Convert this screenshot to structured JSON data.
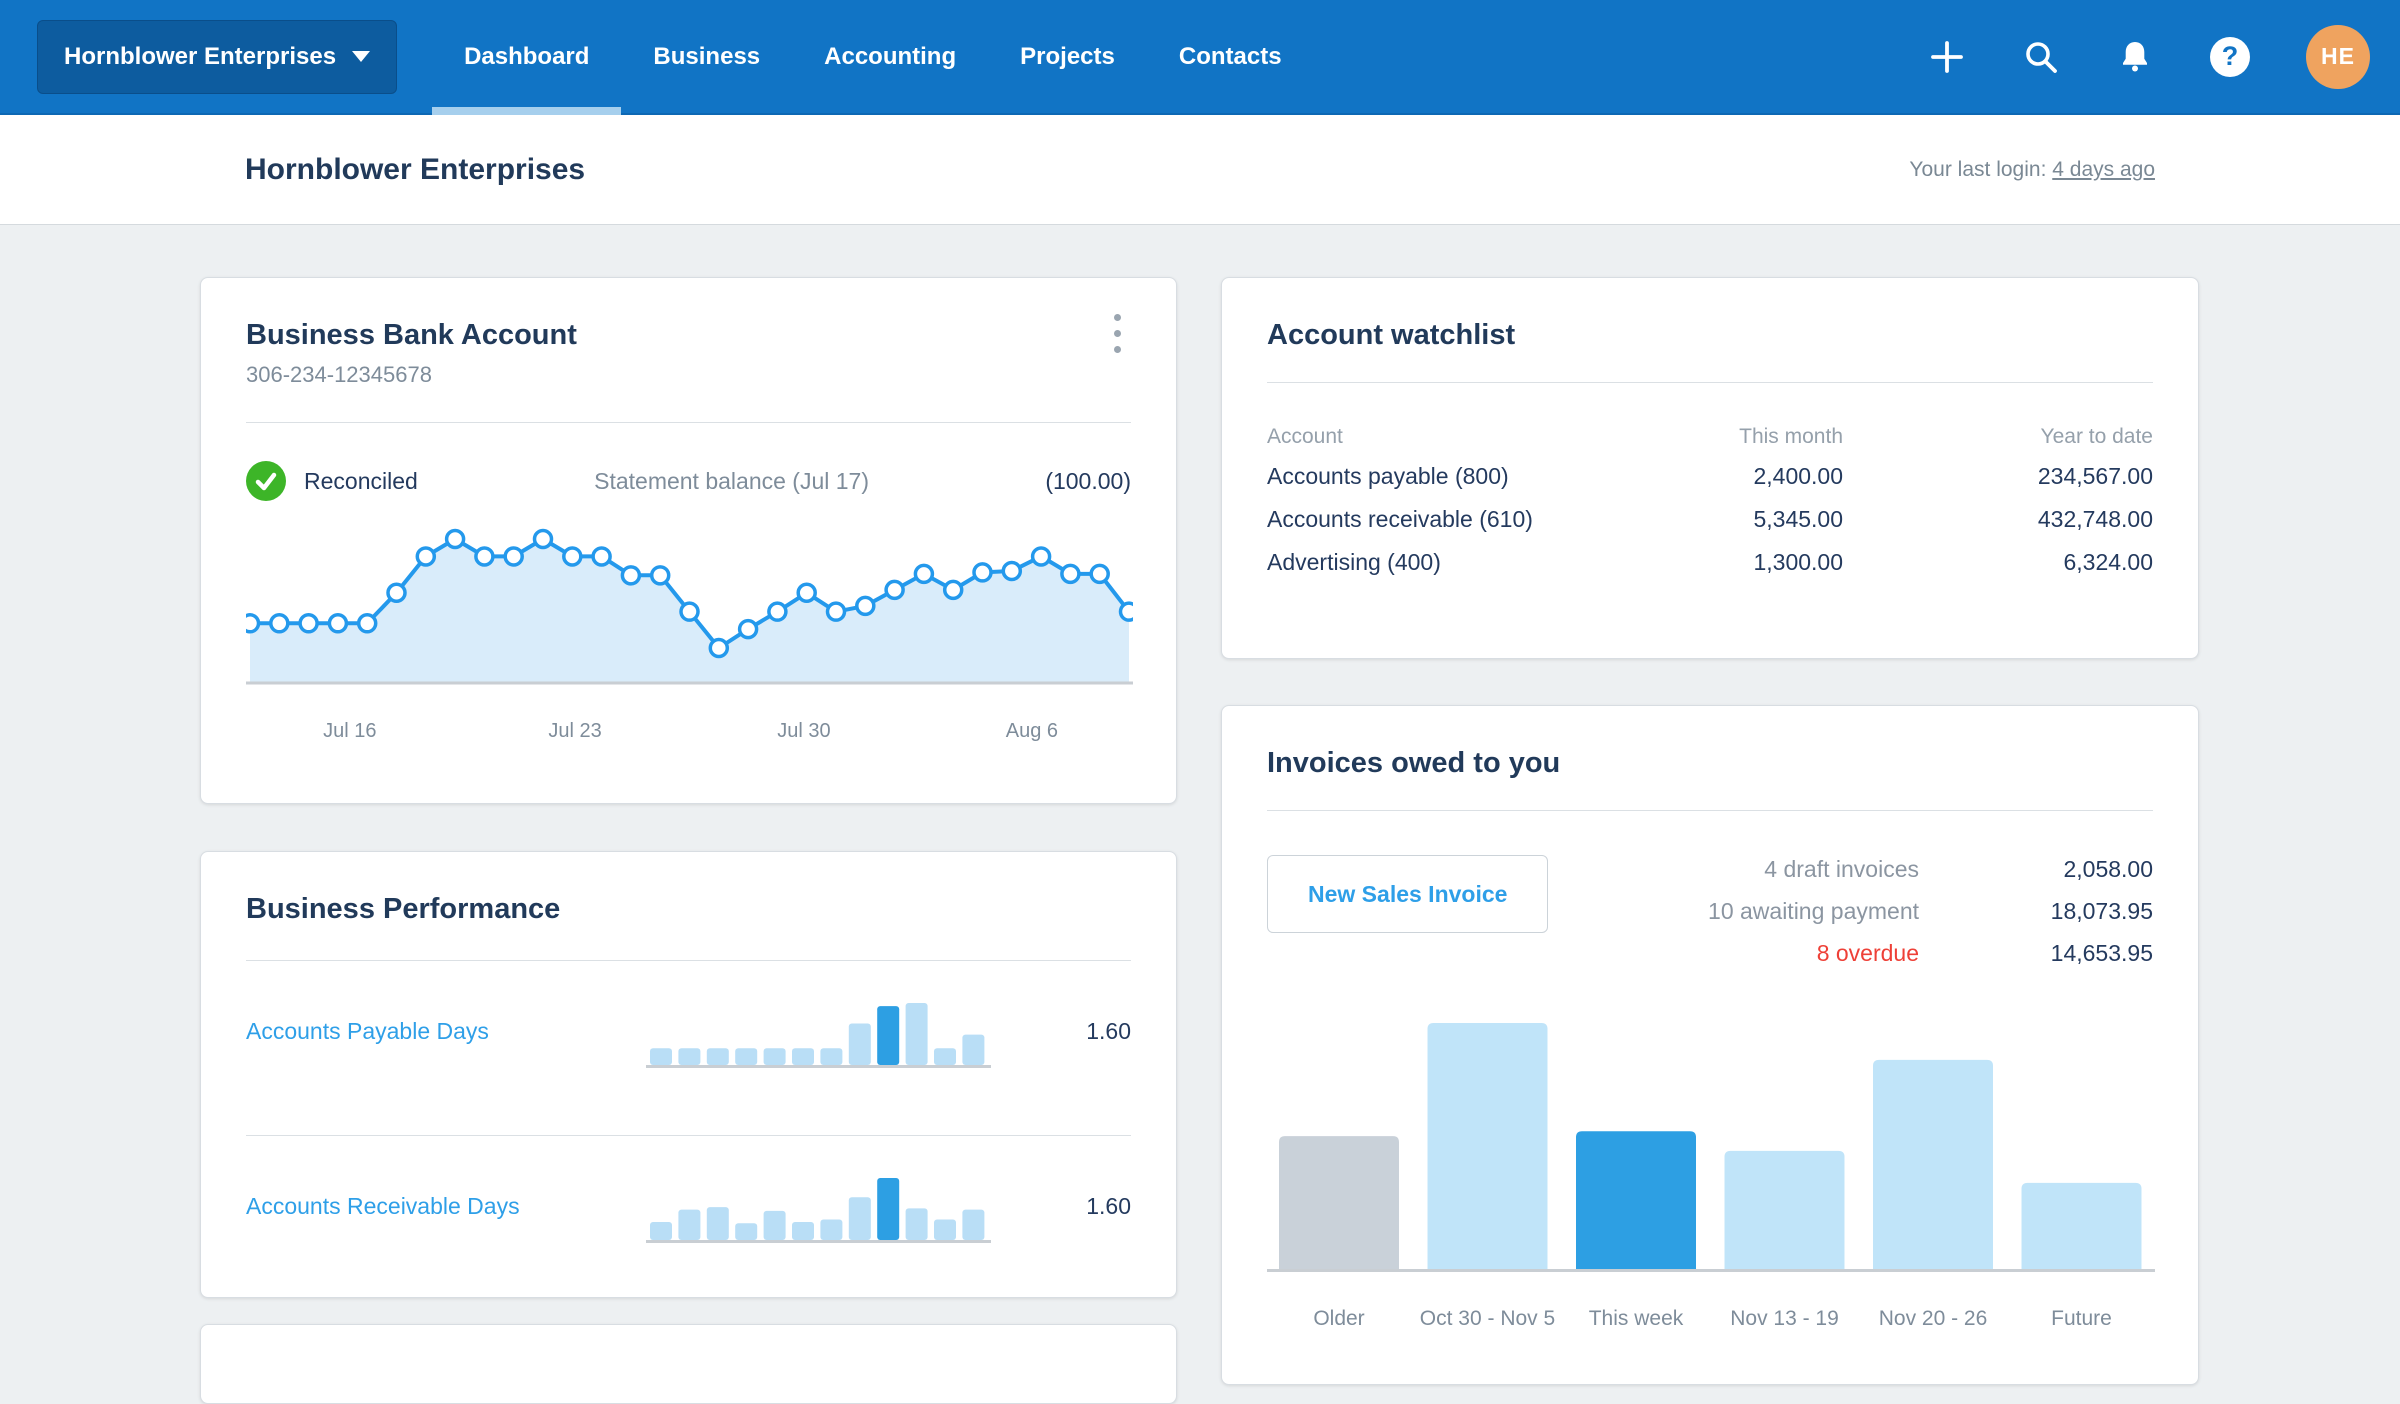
{
  "nav": {
    "org_name": "Hornblower Enterprises",
    "items": [
      {
        "label": "Dashboard",
        "active": true
      },
      {
        "label": "Business",
        "active": false
      },
      {
        "label": "Accounting",
        "active": false
      },
      {
        "label": "Projects",
        "active": false
      },
      {
        "label": "Contacts",
        "active": false
      }
    ],
    "icons": [
      "plus-icon",
      "search-icon",
      "bell-icon",
      "help-icon"
    ],
    "help_glyph": "?",
    "avatar_initials": "HE"
  },
  "header": {
    "title": "Hornblower Enterprises",
    "last_login_label": "Your last login:",
    "last_login_value": "4 days ago"
  },
  "bank_card": {
    "title": "Business Bank Account",
    "account_number": "306-234-12345678",
    "status": "Reconciled",
    "statement_label": "Statement balance (Jul 17)",
    "statement_value": "(100.00)"
  },
  "watchlist": {
    "title": "Account watchlist",
    "columns": [
      "Account",
      "This month",
      "Year to date"
    ],
    "rows": [
      {
        "account": "Accounts payable (800)",
        "this_month": "2,400.00",
        "year_to_date": "234,567.00"
      },
      {
        "account": "Accounts receivable (610)",
        "this_month": "5,345.00",
        "year_to_date": "432,748.00"
      },
      {
        "account": "Advertising (400)",
        "this_month": "1,300.00",
        "year_to_date": "6,324.00"
      }
    ]
  },
  "performance": {
    "title": "Business Performance",
    "rows": [
      {
        "label": "Accounts Payable Days",
        "value": "1.60",
        "spark": [
          27,
          27,
          27,
          27,
          27,
          27,
          27,
          67,
          95,
          100,
          27,
          49
        ],
        "highlight_index": 8
      },
      {
        "label": "Accounts Receivable Days",
        "value": "1.60",
        "spark": [
          29,
          49,
          53,
          27,
          47,
          29,
          33,
          69,
          100,
          51,
          33,
          49
        ],
        "highlight_index": 8
      }
    ]
  },
  "invoices": {
    "title": "Invoices owed to you",
    "new_invoice_button": "New Sales Invoice",
    "stats": [
      {
        "label": "4 draft invoices",
        "value": "2,058.00",
        "overdue": false
      },
      {
        "label": "10 awaiting payment",
        "value": "18,073.95",
        "overdue": false
      },
      {
        "label": "8 overdue",
        "value": "14,653.95",
        "overdue": true
      }
    ]
  },
  "chart_data": [
    {
      "type": "area",
      "title": "Business Bank Account balance sparkline",
      "x_tick_labels": [
        "Jul 16",
        "Jul 23",
        "Jul 30",
        "Aug 6"
      ],
      "x_tick_positions": [
        0.117,
        0.371,
        0.629,
        0.886
      ],
      "ylim": [
        0,
        100
      ],
      "values": [
        42,
        42,
        42,
        42,
        42,
        63,
        88,
        100,
        88,
        88,
        100,
        88,
        88,
        75,
        75,
        50,
        25,
        38,
        50,
        63,
        50,
        54,
        65,
        76,
        65,
        77,
        78,
        88,
        76,
        76,
        50
      ]
    },
    {
      "type": "bar",
      "title": "Invoices owed to you by week",
      "categories": [
        "Older",
        "Oct 30 - Nov 5",
        "This week",
        "Nov 13 - 19",
        "Nov 20 - 26",
        "Future"
      ],
      "values": [
        54,
        100,
        56,
        48,
        85,
        35
      ],
      "bar_styles": [
        "gray",
        "light",
        "dark",
        "light",
        "light",
        "light"
      ],
      "ylim": [
        0,
        100
      ]
    }
  ],
  "colors": {
    "nav_blue": "#1174c5",
    "org_button_blue": "#0d5c9f",
    "active_tab_underline": "#a6cfed",
    "avatar_orange": "#efa35f",
    "navy_text": "#243a5e",
    "gray_text": "#7e8c9a",
    "link_blue": "#2e9fe8",
    "overdue_red": "#ee4037",
    "reconciled_green": "#3db528",
    "chart_line_blue": "#2499ec",
    "chart_fill_blue": "#d9ecfa",
    "bar_light_blue": "#c0e4f9",
    "bar_dark_blue": "#2d9fe3",
    "bar_gray": "#c9d1d9",
    "baseline_gray": "#c9ced3"
  }
}
